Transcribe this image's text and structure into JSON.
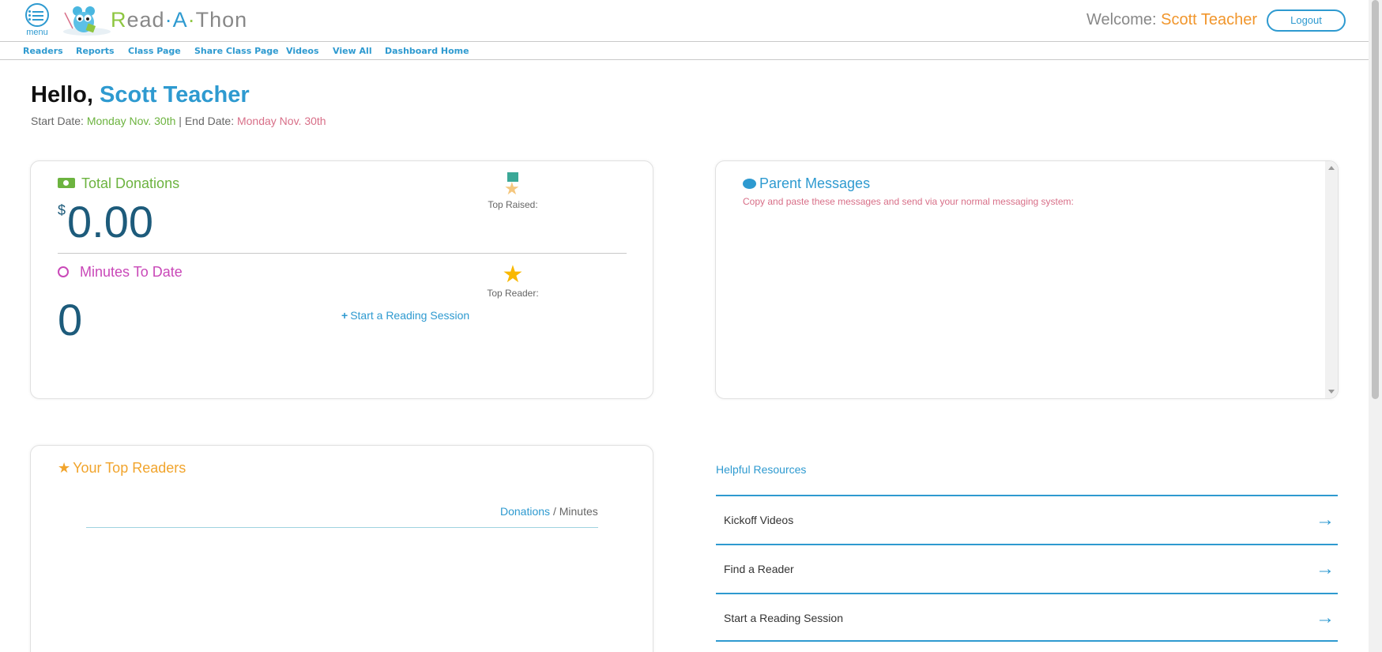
{
  "header": {
    "menu_label": "menu",
    "logo_text": {
      "r": "R",
      "ead": "ead",
      "dot1": "·",
      "a": "A",
      "dot2": "·",
      "t": "T",
      "hon": "hon"
    },
    "welcome_label": "Welcome:",
    "user_name": "Scott Teacher",
    "logout_label": "Logout"
  },
  "nav": {
    "items": [
      {
        "label": "Readers"
      },
      {
        "label": "Reports"
      },
      {
        "label": "Class Page"
      },
      {
        "label": "Share Class Page"
      },
      {
        "label": "Videos"
      },
      {
        "label": "View All"
      },
      {
        "label": "Dashboard Home"
      }
    ]
  },
  "greeting": {
    "hello": "Hello,",
    "name": "Scott Teacher",
    "start_label": "Start Date:",
    "start_date": "Monday Nov. 30th",
    "separator": "|",
    "end_label": "End Date:",
    "end_date": "Monday Nov. 30th"
  },
  "stats": {
    "donations_title": "Total Donations",
    "currency": "$",
    "donations_amount": "0.00",
    "top_raised_label": "Top Raised:",
    "minutes_title": "Minutes To Date",
    "minutes_value": "0",
    "top_reader_label": "Top Reader:",
    "start_session_label": "Start a Reading Session"
  },
  "parent_messages": {
    "title": "Parent Messages",
    "subtitle": "Copy and paste these messages and send via your normal messaging system:"
  },
  "top_readers": {
    "title": "Your Top Readers",
    "toggle_donations": "Donations",
    "toggle_separator": "/",
    "toggle_minutes": "Minutes"
  },
  "resources": {
    "title": "Helpful Resources",
    "items": [
      {
        "label": "Kickoff Videos"
      },
      {
        "label": "Find a Reader"
      },
      {
        "label": "Start a Reading Session"
      }
    ]
  },
  "colors": {
    "primary": "#2e9ad0",
    "green": "#6cb33f",
    "pink": "#d86f88",
    "magenta": "#c948b8",
    "orange": "#f1962c",
    "dark_number": "#1d5b7b"
  },
  "icons": [
    "menu-icon",
    "cash-icon",
    "stopwatch-icon",
    "medal-icon",
    "star-icon",
    "speech-bubble-icon",
    "plus-icon",
    "arrow-right-icon"
  ]
}
